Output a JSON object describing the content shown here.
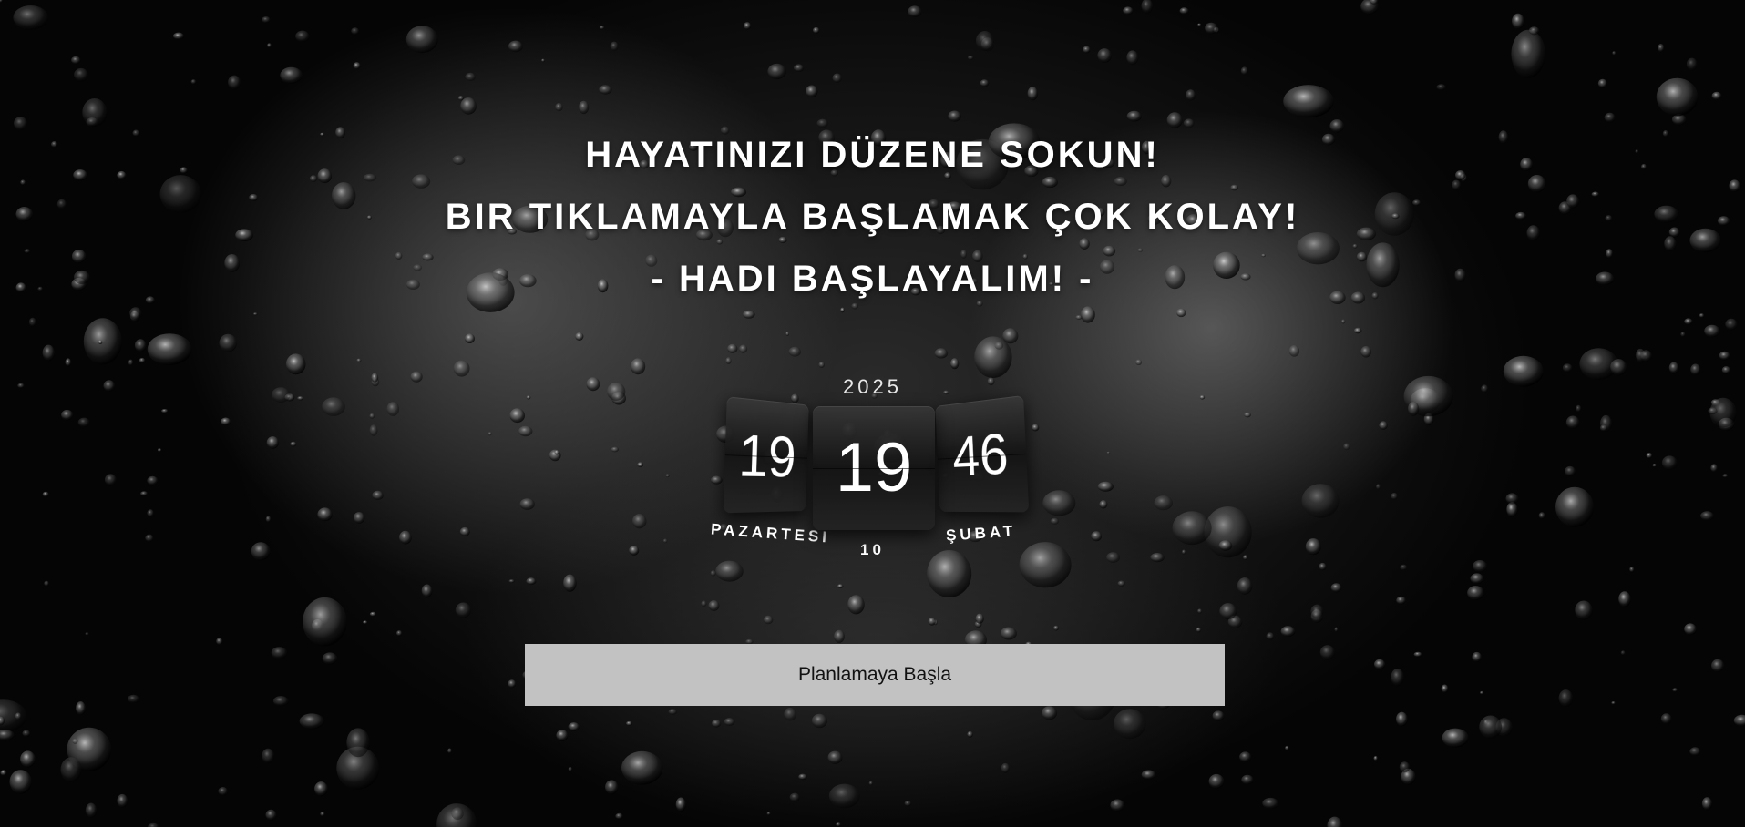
{
  "hero": {
    "line1": "HAYATINIZI DÜZENE SOKUN!",
    "line2": "BIR TIKLAMAYLA BAŞLAMAK ÇOK KOLAY!",
    "line3": "- HADI BAŞLAYALIM! -"
  },
  "clock": {
    "year": "2025",
    "hour": "19",
    "minute": "19",
    "second": "46",
    "weekday": "PAZARTESI",
    "day": "10",
    "month": "ŞUBAT"
  },
  "actions": {
    "start_label": "Planlamaya Başla"
  }
}
